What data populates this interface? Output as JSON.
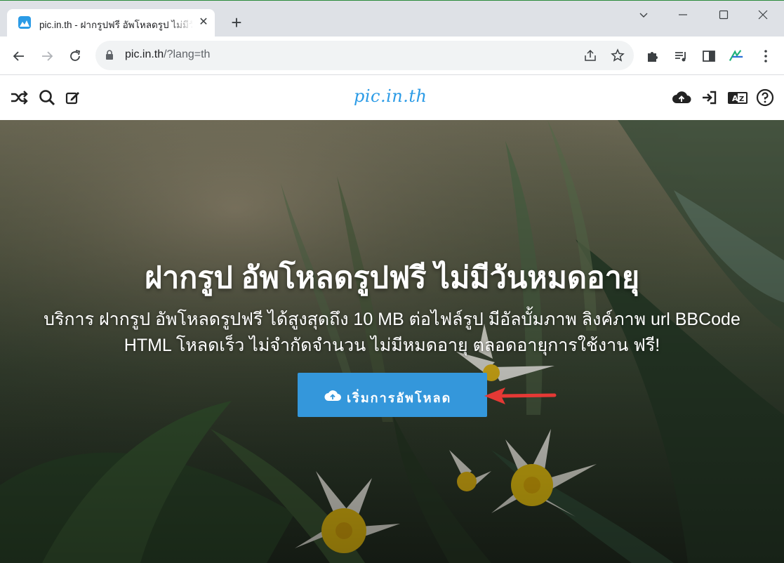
{
  "browser": {
    "tab_title": "pic.in.th - ฝากรูปฟรี อัพโหลดรูป ไม่มีวันหมดอายุ",
    "tab_close": "✕",
    "new_tab": "+",
    "url_host": "pic.in.th",
    "url_rest": "/?lang=th"
  },
  "site": {
    "logo": "pic.in.th"
  },
  "hero": {
    "title": "ฝากรูป อัพโหลดรูปฟรี ไม่มีวันหมดอายุ",
    "description_line1": "บริการ ฝากรูป อัพโหลดรูปฟรี ได้สูงสุดถึง 10 MB ต่อไฟล์รูป มีอัลบั้มภาพ ลิงค์ภาพ url BBCode",
    "description_line2": "HTML โหลดเร็ว ไม่จำกัดจำนวน ไม่มีหมดอายุ ตลอดอายุการใช้งาน ฟรี!",
    "upload_button": "เริ่มการอัพโหลด"
  },
  "colors": {
    "accent": "#3497db",
    "annotation_arrow": "#e53935"
  }
}
